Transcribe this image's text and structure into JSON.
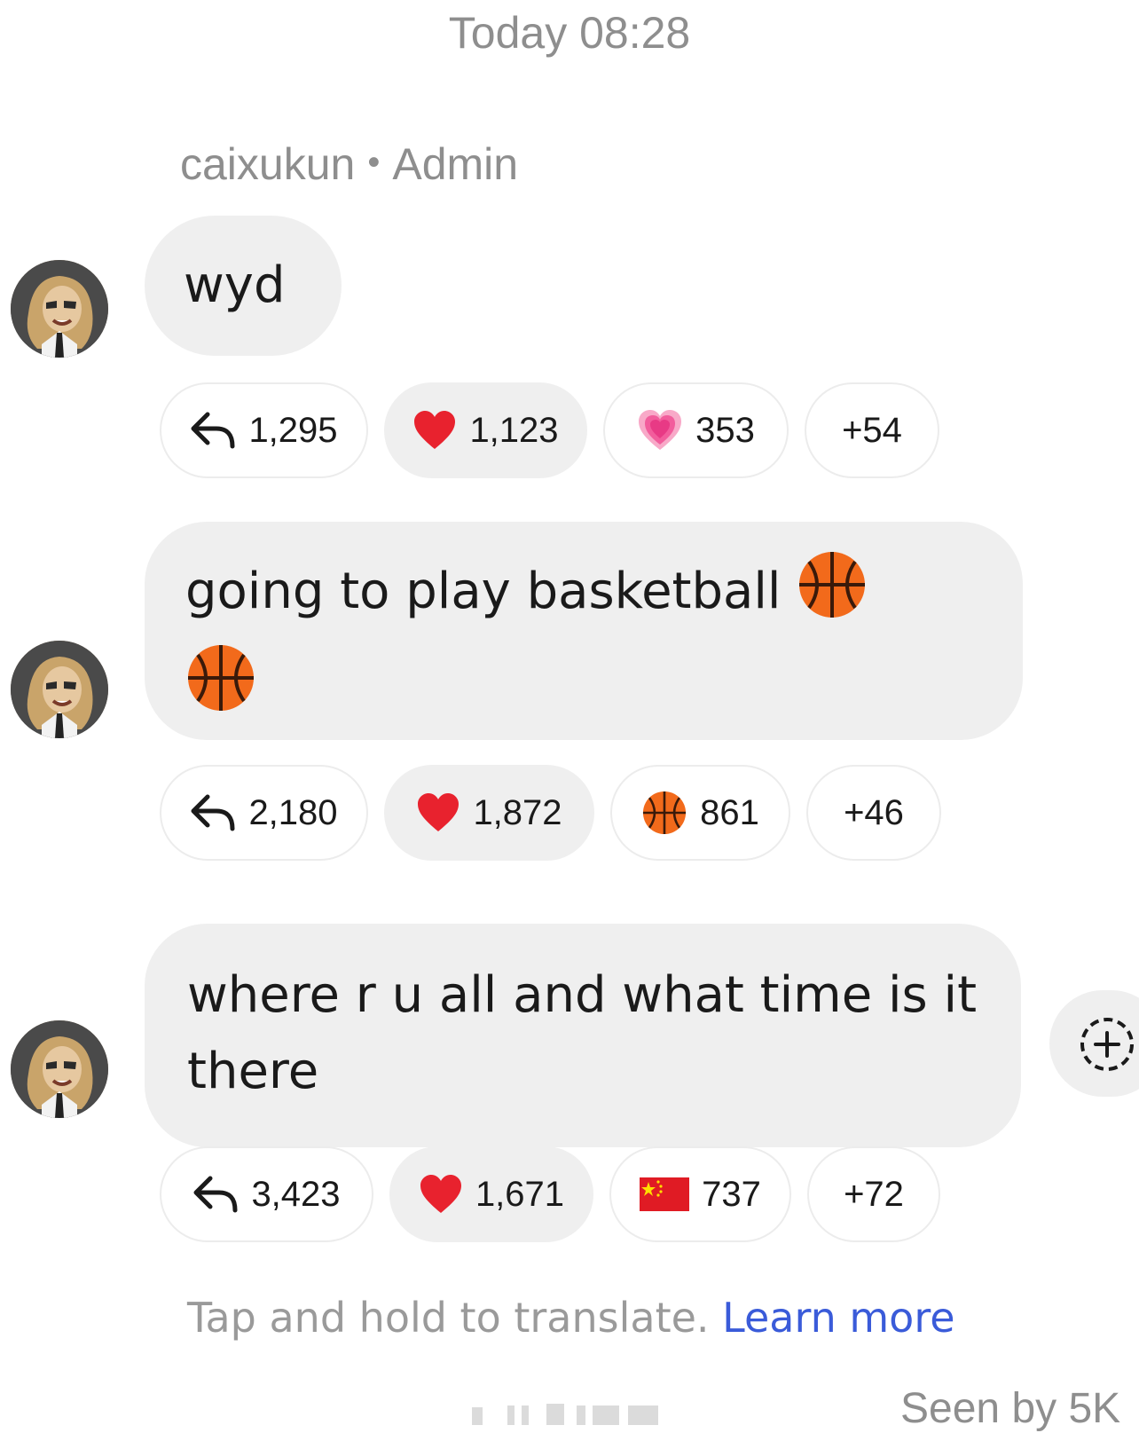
{
  "thread": {
    "timestamp": "Today 08:28",
    "sender_name": "caixukun",
    "sender_separator": "•",
    "sender_role": "Admin"
  },
  "messages": [
    {
      "text": "wyd",
      "reactions": {
        "reply_count": "1,295",
        "primary_emoji": "red-heart",
        "primary_count": "1,123",
        "secondary_emoji": "growing-heart",
        "secondary_count": "353",
        "more_count": "+54"
      }
    },
    {
      "text": "going to play basketball ",
      "inline_emoji": "basketball",
      "reactions": {
        "reply_count": "2,180",
        "primary_emoji": "red-heart",
        "primary_count": "1,872",
        "secondary_emoji": "basketball",
        "secondary_count": "861",
        "more_count": "+46"
      }
    },
    {
      "text": "where r u all and what time is it there",
      "reactions": {
        "reply_count": "3,423",
        "primary_emoji": "red-heart",
        "primary_count": "1,671",
        "secondary_emoji": "china-flag",
        "secondary_count": "737",
        "more_count": "+72"
      }
    }
  ],
  "footer": {
    "translate_hint": "Tap and hold to translate.",
    "learn_more": "Learn more",
    "seen_by": "Seen by 5K"
  },
  "colors": {
    "bubble_bg": "#efefef",
    "muted_text": "#8e8e8e",
    "link": "#3a5bd9",
    "heart": "#e8222e",
    "basketball": "#f26a1b"
  }
}
